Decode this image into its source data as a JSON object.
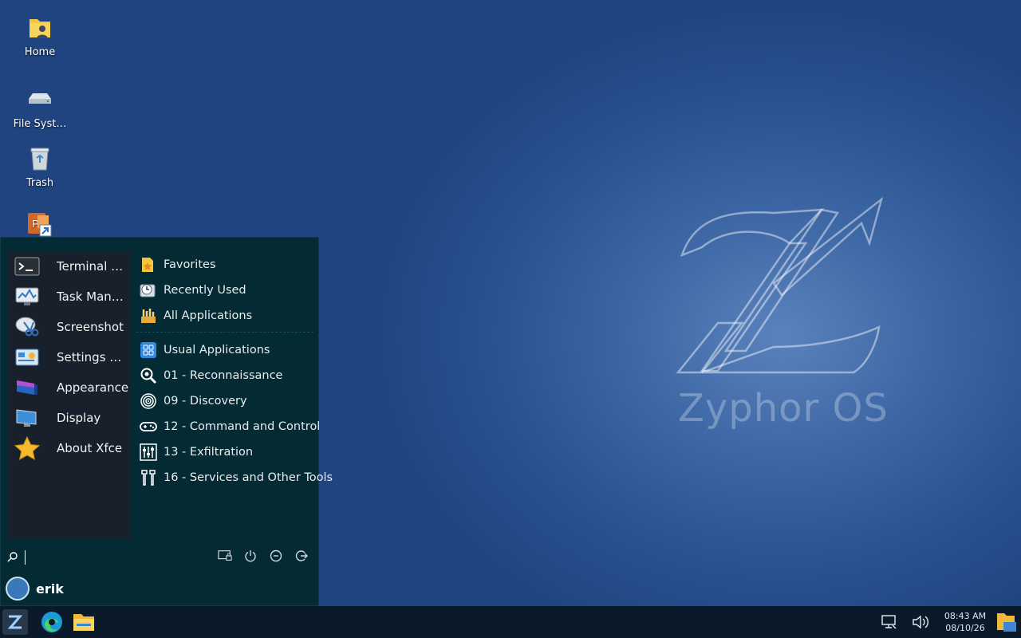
{
  "desktop": {
    "icons": [
      {
        "label": "Home",
        "icon": "home-folder-icon"
      },
      {
        "label": "File Syst…",
        "icon": "drive-icon"
      },
      {
        "label": "Trash",
        "icon": "trash-icon"
      },
      {
        "label": "",
        "icon": "powerpoint-shortcut-icon"
      }
    ],
    "brand_text": "Zyphor OS"
  },
  "menu": {
    "favorites": [
      {
        "label": "Terminal …",
        "icon": "terminal-icon"
      },
      {
        "label": "Task Man…",
        "icon": "task-manager-icon"
      },
      {
        "label": "Screenshot",
        "icon": "screenshot-icon"
      },
      {
        "label": "Settings …",
        "icon": "settings-manager-icon"
      },
      {
        "label": "Appearance",
        "icon": "appearance-icon"
      },
      {
        "label": "Display",
        "icon": "display-icon"
      },
      {
        "label": "About Xfce",
        "icon": "about-xfce-icon"
      }
    ],
    "sections": [
      {
        "label": "Favorites",
        "icon": "favorites-icon"
      },
      {
        "label": "Recently Used",
        "icon": "recently-used-icon"
      },
      {
        "label": "All Applications",
        "icon": "all-applications-icon"
      }
    ],
    "categories": [
      {
        "label": "Usual Applications",
        "icon": "usual-apps-icon"
      },
      {
        "label": "01 - Reconnaissance",
        "icon": "magnifier-icon"
      },
      {
        "label": "09 - Discovery",
        "icon": "radar-icon"
      },
      {
        "label": "12 - Command and Control",
        "icon": "gamepad-icon"
      },
      {
        "label": "13 - Exfiltration",
        "icon": "exfiltration-icon"
      },
      {
        "label": "16 - Services and Other Tools",
        "icon": "tools-icon"
      }
    ],
    "search_value": "",
    "user": "erik"
  },
  "taskbar": {
    "clock_time": "08:43 AM",
    "clock_date": "08/10/26"
  },
  "colors": {
    "menu_bg": "#042a33",
    "fav_panel_bg": "#18202c",
    "taskbar_bg": "#0b1a2a"
  }
}
